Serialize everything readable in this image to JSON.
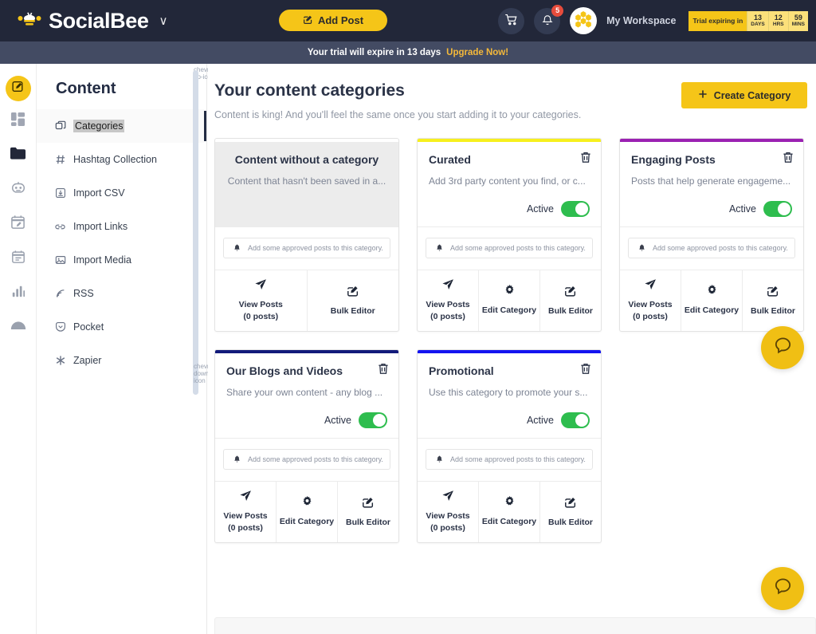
{
  "topnav": {
    "brand": "SocialBee",
    "brand_caret": "∨",
    "logo_icon": "bee-logo-icon",
    "add_post_label": "Add Post",
    "cart_icon": "shopping-cart-icon",
    "bell_icon": "bell-icon",
    "notification_count": "5",
    "workspace_avatar_icon": "honeycomb-avatar-icon",
    "workspace_name": "My Workspace",
    "trial": {
      "label": "Trial expiring in",
      "units": [
        {
          "value": "13",
          "unit": "DAYS"
        },
        {
          "value": "12",
          "unit": "HRS"
        },
        {
          "value": "59",
          "unit": "MINS"
        }
      ]
    }
  },
  "trial_banner": {
    "message": "Your trial will expire in 13 days",
    "cta": "Upgrade Now!"
  },
  "rail": {
    "items": [
      {
        "name": "compose",
        "icon": "pencil-square-icon",
        "active": true
      },
      {
        "name": "dashboard",
        "icon": "dashboard-grid-icon",
        "active": false
      },
      {
        "name": "content",
        "icon": "folder-icon",
        "active": false
      },
      {
        "name": "bot",
        "icon": "robot-icon",
        "active": false
      },
      {
        "name": "editor",
        "icon": "calendar-pencil-icon",
        "active": false
      },
      {
        "name": "calendar",
        "icon": "calendar-icon",
        "active": false
      },
      {
        "name": "analytics",
        "icon": "bar-chart-icon",
        "active": false
      },
      {
        "name": "cloud",
        "icon": "cloud-icon",
        "active": false
      }
    ]
  },
  "sidebar": {
    "title": "Content",
    "items": [
      {
        "label": "Categories",
        "icon": "copy-stack-icon",
        "active": true
      },
      {
        "label": "Hashtag Collection",
        "icon": "hash-icon",
        "active": false
      },
      {
        "label": "Import CSV",
        "icon": "download-box-icon",
        "active": false
      },
      {
        "label": "Import Links",
        "icon": "link-icon",
        "active": false
      },
      {
        "label": "Import Media",
        "icon": "image-icon",
        "active": false
      },
      {
        "label": "RSS",
        "icon": "rss-icon",
        "active": false
      },
      {
        "label": "Pocket",
        "icon": "pocket-icon",
        "active": false
      },
      {
        "label": "Zapier",
        "icon": "zapier-asterisk-icon",
        "active": false
      }
    ],
    "scroll_up_icon": "chevron-up-icon",
    "scroll_down_icon": "chevron-down-icon"
  },
  "main": {
    "title": "Your content categories",
    "subtitle": "Content is king! And you'll feel the same once you start adding it to your categories.",
    "create_button": "Create Category",
    "create_button_icon": "plus-icon",
    "notice_text": "Add some approved posts to this category.",
    "notice_icon": "bell-icon",
    "active_label": "Active",
    "trash_icon": "trash-icon",
    "actions": {
      "view_posts": "View Posts",
      "view_posts_count": "(0 posts)",
      "view_posts_icon": "paper-plane-icon",
      "edit_category": "Edit Category",
      "edit_category_icon": "gear-icon",
      "bulk_editor": "Bulk Editor",
      "bulk_editor_icon": "pencil-square-icon"
    },
    "cards": [
      {
        "id": "uncategorized",
        "title": "Content without a category",
        "description": "Content that hasn't been saved in a...",
        "stripe_color": "transparent",
        "muted": true,
        "centered": true,
        "has_trash": false,
        "has_toggle": false,
        "has_edit": false
      },
      {
        "id": "curated",
        "title": "Curated",
        "description": "Add 3rd party content you find, or c...",
        "stripe_color": "#f7f01e",
        "muted": false,
        "centered": false,
        "has_trash": true,
        "has_toggle": true,
        "has_edit": true
      },
      {
        "id": "engaging-posts",
        "title": "Engaging Posts",
        "description": "Posts that help generate engageme...",
        "stripe_color": "#9b21b2",
        "muted": false,
        "centered": false,
        "has_trash": true,
        "has_toggle": true,
        "has_edit": true
      },
      {
        "id": "our-blogs-and-videos",
        "title": "Our Blogs and Videos",
        "description": "Share your own content - any blog ...",
        "stripe_color": "#121a7a",
        "muted": false,
        "centered": false,
        "has_trash": true,
        "has_toggle": true,
        "has_edit": true
      },
      {
        "id": "promotional",
        "title": "Promotional",
        "description": "Use this category to promote your s...",
        "stripe_color": "#1414f0",
        "muted": false,
        "centered": false,
        "has_trash": true,
        "has_toggle": true,
        "has_edit": true
      }
    ]
  },
  "chat": {
    "icon": "chat-bubble-icon",
    "color": "#f0bf14"
  },
  "colors": {
    "brand_yellow": "#f5c518",
    "nav_dark": "#222739",
    "banner_dark": "#434b63",
    "toggle_green": "#2ebd4e",
    "badge_red": "#e74c3c"
  }
}
